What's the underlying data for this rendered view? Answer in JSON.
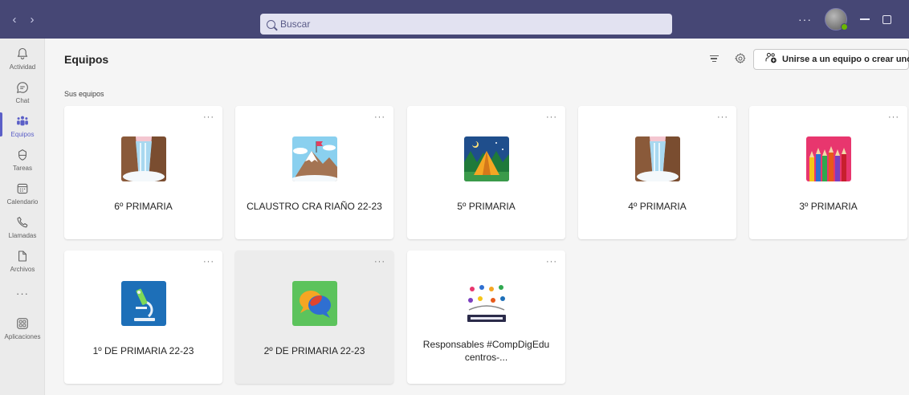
{
  "topbar": {
    "search_placeholder": "Buscar",
    "more_label": "···",
    "accent": "#464775"
  },
  "rail": {
    "items": [
      {
        "label": "Actividad",
        "icon": "bell-icon"
      },
      {
        "label": "Chat",
        "icon": "chat-icon"
      },
      {
        "label": "Equipos",
        "icon": "teams-icon",
        "active": true
      },
      {
        "label": "Tareas",
        "icon": "assignments-icon"
      },
      {
        "label": "Calendario",
        "icon": "calendar-icon"
      },
      {
        "label": "Llamadas",
        "icon": "phone-icon"
      },
      {
        "label": "Archivos",
        "icon": "file-icon"
      },
      {
        "label": "···",
        "icon": "more-icon"
      },
      {
        "label": "Aplicaciones",
        "icon": "apps-icon"
      }
    ],
    "active_color": "#5b5fc7"
  },
  "main": {
    "title": "Equipos",
    "join_button": "Unirse a un equipo o crear uno",
    "section_label": "Sus equipos",
    "teams": [
      {
        "name": "6º PRIMARIA",
        "image": "waterfall"
      },
      {
        "name": "CLAUSTRO CRA RIAÑO 22-23",
        "image": "mountain"
      },
      {
        "name": "5º PRIMARIA",
        "image": "tent"
      },
      {
        "name": "4º PRIMARIA",
        "image": "waterfall"
      },
      {
        "name": "3º PRIMARIA",
        "image": "pencils"
      },
      {
        "name": "1º DE PRIMARIA 22-23",
        "image": "microscope"
      },
      {
        "name": "2º DE PRIMARIA 22-23",
        "image": "chat-bubbles"
      },
      {
        "name": "Responsables #CompDigEdu centros-...",
        "image": "centros-leon-logo"
      }
    ],
    "more_label": "···"
  }
}
